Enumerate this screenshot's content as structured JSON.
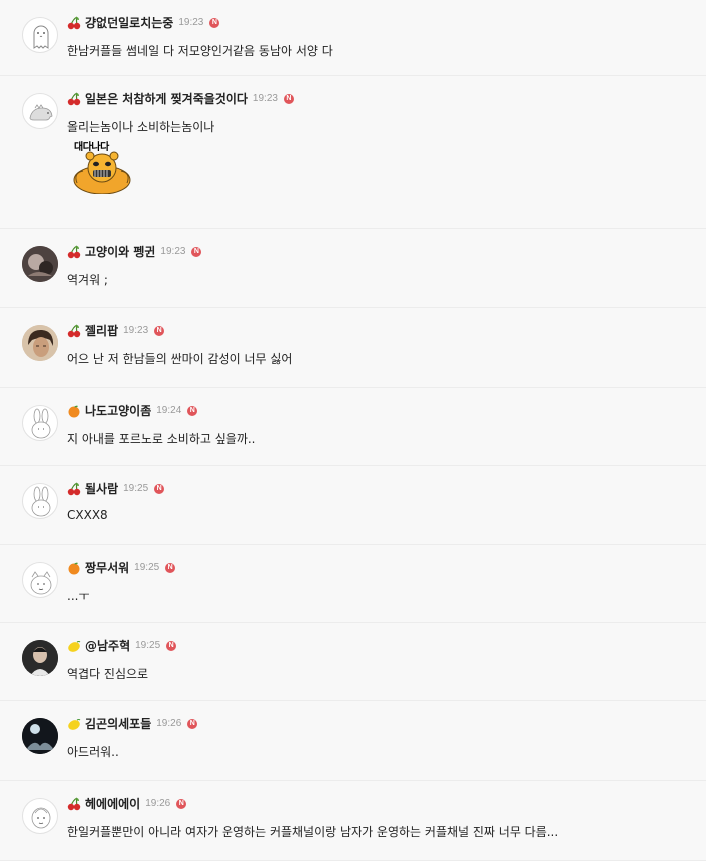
{
  "comments": [
    {
      "badge": "cherry",
      "nick": "걍없던일로치는중",
      "time": "19:23",
      "new": "N",
      "text": "한남커플들 썸네일 다 저모양인거같음 동남아 서양 다"
    },
    {
      "badge": "cherry",
      "nick": "일본은 처참하게 찢겨죽을것이다",
      "time": "19:23",
      "new": "N",
      "text": "올리는놈이나 소비하는놈이나",
      "sticker_caption": "대다나다"
    },
    {
      "badge": "cherry",
      "nick": "고양이와 펭귄",
      "time": "19:23",
      "new": "N",
      "text": "역겨워 ;"
    },
    {
      "badge": "cherry",
      "nick": "젤리팝",
      "time": "19:23",
      "new": "N",
      "text": "어으 난 저 한남들의 싼마이 감성이 너무 싫어"
    },
    {
      "badge": "orange",
      "nick": "나도고양이좀",
      "time": "19:24",
      "new": "N",
      "text": "지 아내를 포르노로 소비하고 싶을까.."
    },
    {
      "badge": "cherry",
      "nick": "될사람",
      "time": "19:25",
      "new": "N",
      "text": "CXXX8"
    },
    {
      "badge": "orange",
      "nick": "짱무서워",
      "time": "19:25",
      "new": "N",
      "text": "...ㅜ"
    },
    {
      "badge": "lemon",
      "nick": "@남주혁",
      "time": "19:25",
      "new": "N",
      "text": "역겹다 진심으로"
    },
    {
      "badge": "lemon",
      "nick": "김곤의세포들",
      "time": "19:26",
      "new": "N",
      "text": "아드러워.."
    },
    {
      "badge": "cherry",
      "nick": "헤에에에이",
      "time": "19:26",
      "new": "N",
      "text": "한일커플뿐만이 아니라 여자가 운영하는 커플채널이랑 남자가 운영하는 커플채널 진짜 너무 다름..."
    }
  ]
}
